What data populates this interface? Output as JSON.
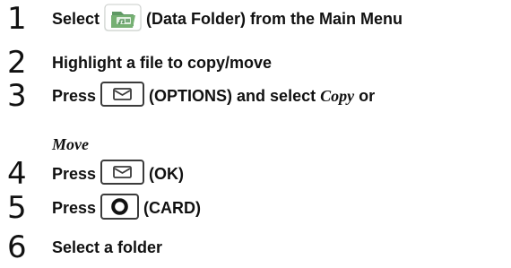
{
  "steps": [
    {
      "number": "1",
      "text_before": "Select",
      "icon": "data-folder-icon",
      "text_after": "(Data Folder) from the Main Menu"
    },
    {
      "number": "2",
      "text": "Highlight a file to copy/move"
    },
    {
      "number": "3",
      "text_before": "Press",
      "key_icon": "envelope-key-icon",
      "text_middle": "(OPTIONS) and select",
      "option_copy": "Copy",
      "text_or": "or",
      "option_move": "Move"
    },
    {
      "number": "4",
      "text_before": "Press",
      "key_icon": "envelope-key-icon",
      "text_after": "(OK)"
    },
    {
      "number": "5",
      "text_before": "Press",
      "key_icon": "o-key-icon",
      "text_after": "(CARD)"
    },
    {
      "number": "6",
      "text": "Select a folder"
    }
  ],
  "colors": {
    "text": "#111111",
    "icon_outline": "#3b3b3b",
    "folder_green": "#68a36a"
  }
}
